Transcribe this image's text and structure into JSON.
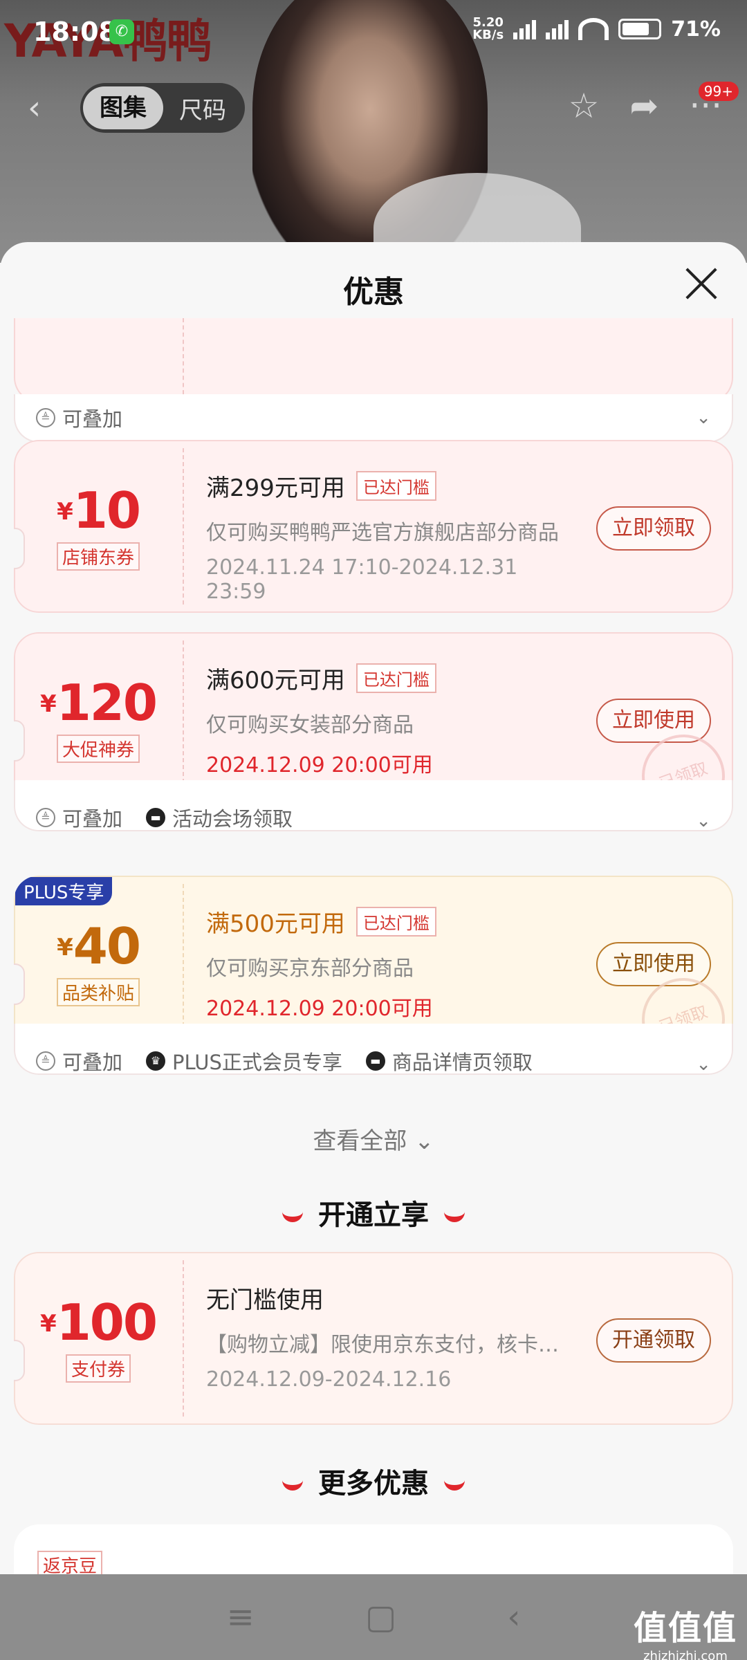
{
  "status": {
    "time": "18:08",
    "net_speed": "5.20",
    "net_unit": "KB/s",
    "battery": "71%"
  },
  "hero": {
    "brand": "YAYA鸭鸭",
    "cart_badge": "99+"
  },
  "nav": {
    "tab_active": "图集",
    "tab_other": "尺码"
  },
  "sheet": {
    "title": "优惠"
  },
  "top_partial": {
    "stack": "可叠加"
  },
  "coupons": [
    {
      "yen": "¥",
      "amount": "10",
      "type": "店铺东券",
      "condition": "满299元可用",
      "reach": "已达门槛",
      "desc": "仅可购买鸭鸭严选官方旗舰店部分商品",
      "date": "2024.11.24 17:10-2024.12.31 23:59",
      "button": "立即领取"
    },
    {
      "yen": "¥",
      "amount": "120",
      "type": "大促神券",
      "condition": "满600元可用",
      "reach": "已达门槛",
      "desc": "仅可购买女装部分商品",
      "date": "2024.12.09 20:00可用",
      "button": "立即使用",
      "stamp": "已领取",
      "tags": [
        "可叠加",
        "活动会场领取"
      ]
    },
    {
      "plus": "PLUS专享",
      "yen": "¥",
      "amount": "40",
      "type": "品类补贴",
      "condition": "满500元可用",
      "reach": "已达门槛",
      "desc": "仅可购买京东部分商品",
      "date": "2024.12.09 20:00可用",
      "button": "立即使用",
      "stamp": "已领取",
      "tags": [
        "可叠加",
        "PLUS正式会员专享",
        "商品详情页领取"
      ]
    }
  ],
  "see_all": "查看全部 ⌄",
  "section_open": "开通立享",
  "pay_coupon": {
    "yen": "¥",
    "amount": "100",
    "type": "支付券",
    "condition": "无门槛使用",
    "desc": "【购物立减】限使用京东支付，核卡…",
    "date": "2024.12.09-2024.12.16",
    "button": "开通领取"
  },
  "section_more": "更多优惠",
  "more_tag": "返京豆",
  "watermark": {
    "big": "值值值",
    "small": "zhizhizhi.com"
  }
}
